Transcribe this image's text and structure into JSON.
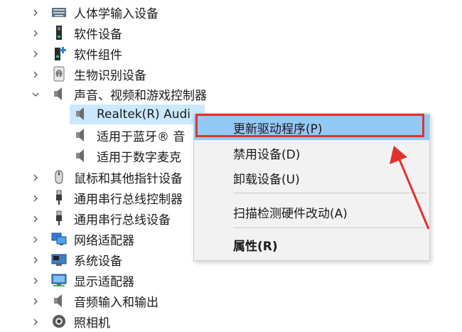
{
  "tree": {
    "items": [
      {
        "label": "人体学输入设备",
        "expanded": false
      },
      {
        "label": "软件设备",
        "expanded": false
      },
      {
        "label": "软件组件",
        "expanded": false
      },
      {
        "label": "生物识别设备",
        "expanded": false
      },
      {
        "label": "声音、视频和游戏控制器",
        "expanded": true
      },
      {
        "label": "Realtek(R) Audi",
        "child": true,
        "selected": true
      },
      {
        "label": "适用于蓝牙® 音",
        "child": true
      },
      {
        "label": "适用于数字麦克",
        "child": true
      },
      {
        "label": "鼠标和其他指针设备",
        "expanded": false
      },
      {
        "label": "通用串行总线控制器",
        "expanded": false
      },
      {
        "label": "通用串行总线设备",
        "expanded": false
      },
      {
        "label": "网络适配器",
        "expanded": false
      },
      {
        "label": "系统设备",
        "expanded": false
      },
      {
        "label": "显示适配器",
        "expanded": false
      },
      {
        "label": "音频输入和输出",
        "expanded": false
      },
      {
        "label": "照相机",
        "expanded": false
      }
    ]
  },
  "context_menu": {
    "update_driver": "更新驱动程序(P)",
    "disable_device": "禁用设备(D)",
    "uninstall_device": "卸载设备(U)",
    "scan_hardware": "扫描检测硬件改动(A)",
    "properties": "属性(R)"
  },
  "colors": {
    "selection": "#cce8ff",
    "menu_highlight": "#91c9f7",
    "annotation_red": "#e0322f"
  }
}
